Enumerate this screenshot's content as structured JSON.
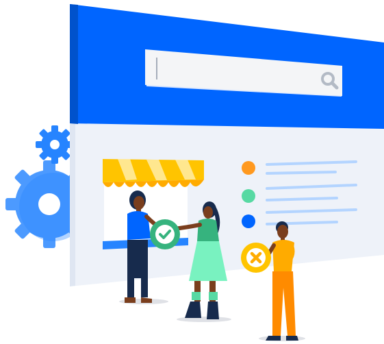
{
  "search": {
    "value": "",
    "placeholder": ""
  },
  "icons": {
    "search": "search-icon",
    "gear_large": "gear-icon",
    "gear_small": "gear-icon",
    "approve": "checkmark-icon",
    "reject": "close-icon"
  },
  "list_bullets": [
    {
      "color": "#ff991f"
    },
    {
      "color": "#57d9a3"
    },
    {
      "color": "#0065ff"
    }
  ],
  "colors": {
    "header_blue": "#0065ff",
    "page_bg": "#eef2f9",
    "awning_yellow": "#ffc400",
    "accept_green": "#36b37e",
    "reject_orange": "#ffab00",
    "line_blue": "#b3d4ff",
    "gear_blue": "#4c9aff"
  }
}
